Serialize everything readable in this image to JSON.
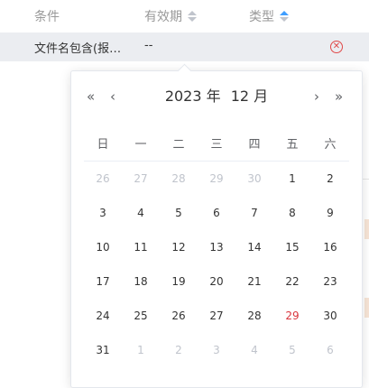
{
  "table": {
    "headers": {
      "condition": "条件",
      "validity": "有效期",
      "type": "类型"
    },
    "row": {
      "condition": "文件名包含(报…",
      "validity": "--"
    }
  },
  "calendar": {
    "year": "2023 年",
    "month": "12 月",
    "nav": {
      "prev_year": "«",
      "prev_month": "‹",
      "next_month": "›",
      "next_year": "»"
    },
    "weekdays": [
      "日",
      "一",
      "二",
      "三",
      "四",
      "五",
      "六"
    ],
    "weeks": [
      [
        {
          "d": "26",
          "o": true
        },
        {
          "d": "27",
          "o": true
        },
        {
          "d": "28",
          "o": true
        },
        {
          "d": "29",
          "o": true
        },
        {
          "d": "30",
          "o": true
        },
        {
          "d": "1"
        },
        {
          "d": "2"
        }
      ],
      [
        {
          "d": "3"
        },
        {
          "d": "4"
        },
        {
          "d": "5"
        },
        {
          "d": "6"
        },
        {
          "d": "7"
        },
        {
          "d": "8"
        },
        {
          "d": "9"
        }
      ],
      [
        {
          "d": "10"
        },
        {
          "d": "11"
        },
        {
          "d": "12"
        },
        {
          "d": "13"
        },
        {
          "d": "14"
        },
        {
          "d": "15"
        },
        {
          "d": "16"
        }
      ],
      [
        {
          "d": "17"
        },
        {
          "d": "18"
        },
        {
          "d": "19"
        },
        {
          "d": "20"
        },
        {
          "d": "21"
        },
        {
          "d": "22"
        },
        {
          "d": "23"
        }
      ],
      [
        {
          "d": "24"
        },
        {
          "d": "25"
        },
        {
          "d": "26"
        },
        {
          "d": "27"
        },
        {
          "d": "28"
        },
        {
          "d": "29",
          "today": true
        },
        {
          "d": "30"
        }
      ],
      [
        {
          "d": "31"
        },
        {
          "d": "1",
          "o": true
        },
        {
          "d": "2",
          "o": true
        },
        {
          "d": "3",
          "o": true
        },
        {
          "d": "4",
          "o": true
        },
        {
          "d": "5",
          "o": true
        },
        {
          "d": "6",
          "o": true
        }
      ]
    ]
  },
  "colors": {
    "sort_active": "#409eff",
    "today": "#d9363e",
    "delete": "#e04848",
    "row_bg": "#ebedf1"
  }
}
